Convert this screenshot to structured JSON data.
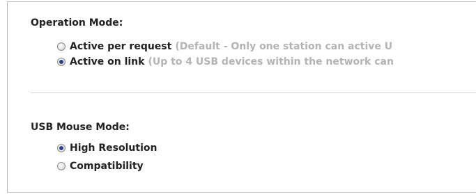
{
  "operation_mode": {
    "title": "Operation Mode:",
    "options": [
      {
        "label": "Active per request",
        "description": "(Default - Only one station can active U",
        "checked": false
      },
      {
        "label": "Active on link",
        "description": "(Up to 4 USB devices within the network can",
        "checked": true
      }
    ]
  },
  "usb_mouse_mode": {
    "title": "USB Mouse Mode:",
    "options": [
      {
        "label": "High Resolution",
        "checked": true
      },
      {
        "label": "Compatibility",
        "checked": false
      }
    ]
  }
}
